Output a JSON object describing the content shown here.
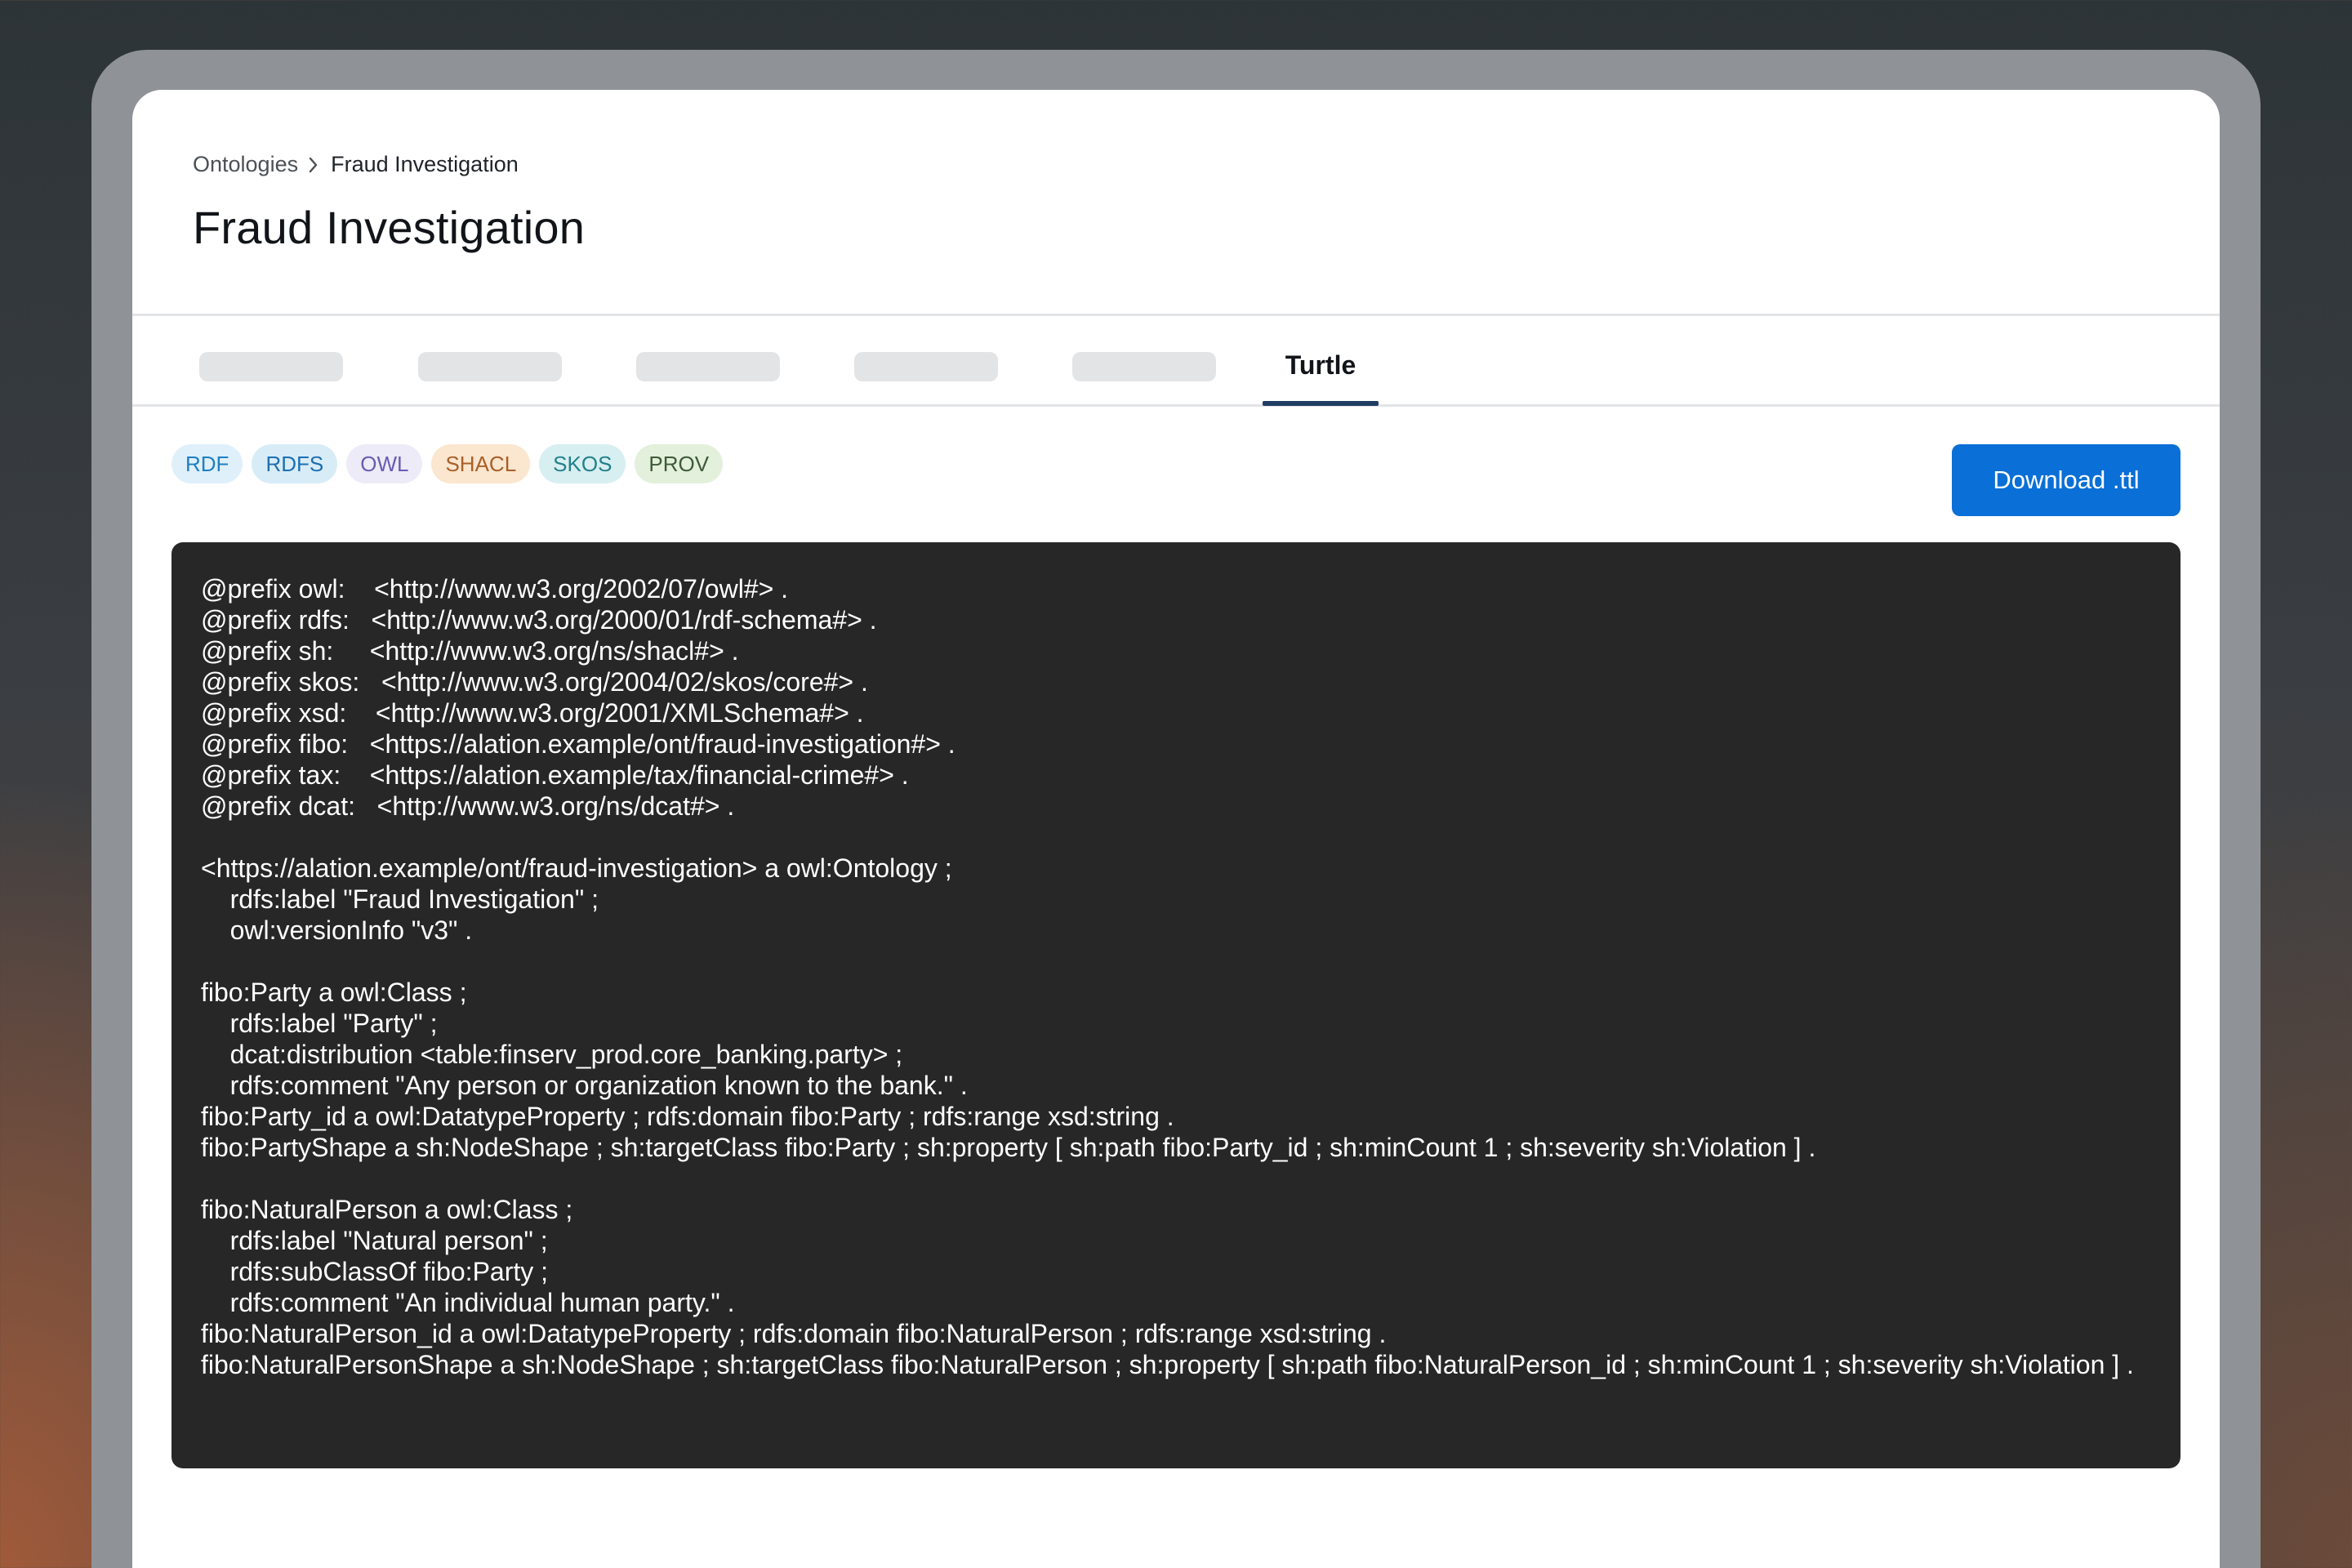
{
  "breadcrumb": {
    "root": "Ontologies",
    "current": "Fraud Investigation"
  },
  "page": {
    "title": "Fraud Investigation"
  },
  "tabs": {
    "placeholder_count": 5,
    "active_label": "Turtle"
  },
  "vocab_badges": [
    {
      "label": "RDF",
      "bg": "#dff0fb",
      "fg": "#1f7fc2"
    },
    {
      "label": "RDFS",
      "bg": "#d8ecf8",
      "fg": "#1d6fb0"
    },
    {
      "label": "OWL",
      "bg": "#ecebf7",
      "fg": "#6a5bb5"
    },
    {
      "label": "SHACL",
      "bg": "#fbe6cf",
      "fg": "#a8612a"
    },
    {
      "label": "SKOS",
      "bg": "#d7eff1",
      "fg": "#23808a"
    },
    {
      "label": "PROV",
      "bg": "#e2f0dc",
      "fg": "#3f5a38"
    }
  ],
  "download_label": "Download .ttl",
  "turtle_source": "@prefix owl:    <http://www.w3.org/2002/07/owl#> .\n@prefix rdfs:   <http://www.w3.org/2000/01/rdf-schema#> .\n@prefix sh:     <http://www.w3.org/ns/shacl#> .\n@prefix skos:   <http://www.w3.org/2004/02/skos/core#> .\n@prefix xsd:    <http://www.w3.org/2001/XMLSchema#> .\n@prefix fibo:   <https://alation.example/ont/fraud-investigation#> .\n@prefix tax:    <https://alation.example/tax/financial-crime#> .\n@prefix dcat:   <http://www.w3.org/ns/dcat#> .\n\n<https://alation.example/ont/fraud-investigation> a owl:Ontology ;\n    rdfs:label \"Fraud Investigation\" ;\n    owl:versionInfo \"v3\" .\n\nfibo:Party a owl:Class ;\n    rdfs:label \"Party\" ;\n    dcat:distribution <table:finserv_prod.core_banking.party> ;\n    rdfs:comment \"Any person or organization known to the bank.\" .\nfibo:Party_id a owl:DatatypeProperty ; rdfs:domain fibo:Party ; rdfs:range xsd:string .\nfibo:PartyShape a sh:NodeShape ; sh:targetClass fibo:Party ; sh:property [ sh:path fibo:Party_id ; sh:minCount 1 ; sh:severity sh:Violation ] .\n\nfibo:NaturalPerson a owl:Class ;\n    rdfs:label \"Natural person\" ;\n    rdfs:subClassOf fibo:Party ;\n    rdfs:comment \"An individual human party.\" .\nfibo:NaturalPerson_id a owl:DatatypeProperty ; rdfs:domain fibo:NaturalPerson ; rdfs:range xsd:string .\nfibo:NaturalPersonShape a sh:NodeShape ; sh:targetClass fibo:NaturalPerson ; sh:property [ sh:path fibo:NaturalPerson_id ; sh:minCount 1 ; sh:severity sh:Violation ] ."
}
